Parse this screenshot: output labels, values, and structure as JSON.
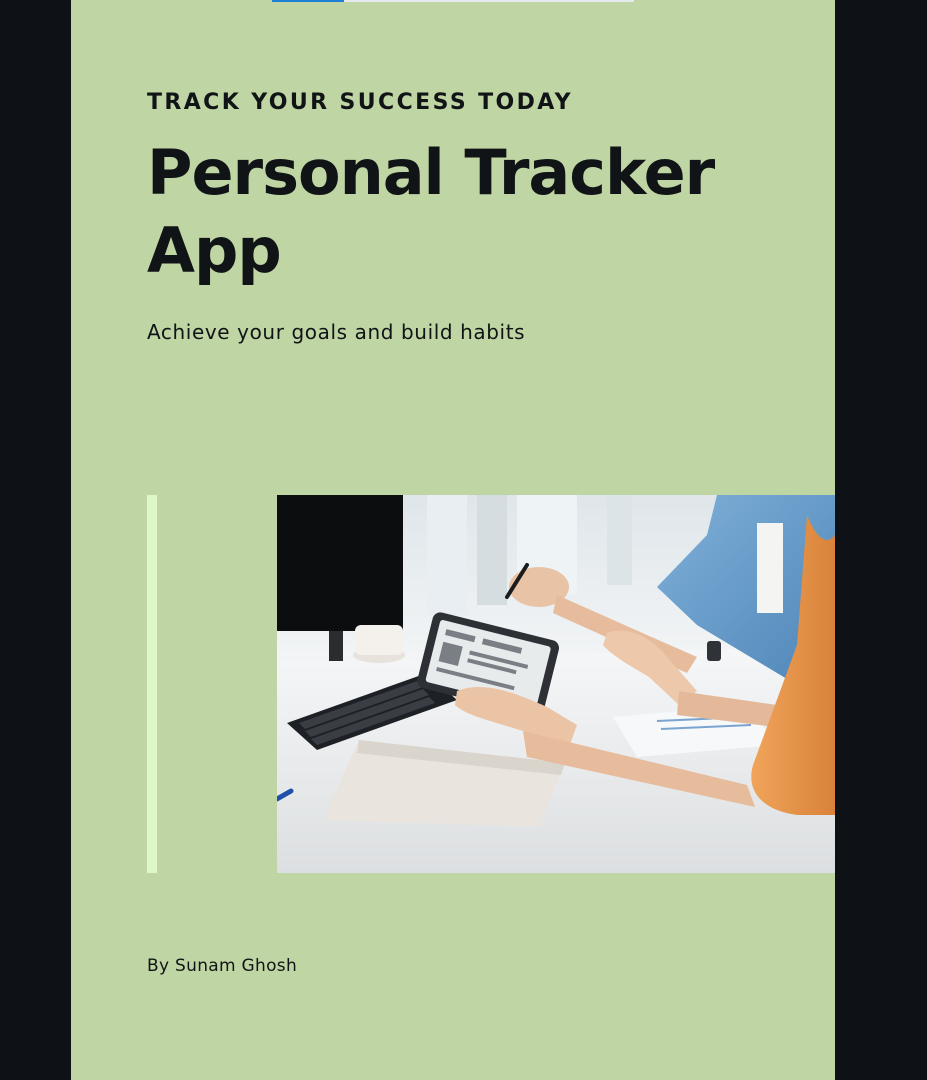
{
  "cover": {
    "eyebrow": "TRACK YOUR SUCCESS TODAY",
    "title": "Personal Tracker App",
    "subtitle": "Achieve your goals and build habits",
    "author": "By Sunam Ghosh"
  },
  "progress": {
    "fraction": 0.2
  },
  "photo": {
    "subject": "people-working-with-tablet-at-desk"
  },
  "colors": {
    "page_background": "#bfd5a3",
    "outer_background": "#0e1217",
    "accent_bar": "#ddf7c6",
    "progress_fill": "#1d7fd6",
    "text": "#111416"
  }
}
